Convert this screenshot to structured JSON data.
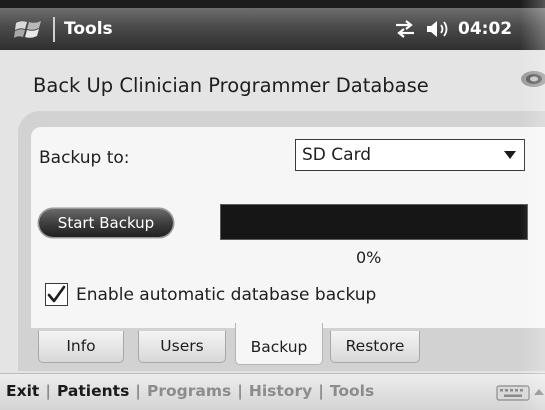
{
  "status_bar": {
    "title": "Tools",
    "time": "04:02",
    "icons": {
      "start": "windows-flag-icon",
      "connectivity": "connectivity-arrows-icon",
      "volume": "speaker-volume-icon"
    }
  },
  "page": {
    "title": "Back Up Clinician Programmer Database",
    "corner_icon": "pod-icon"
  },
  "form": {
    "backup_to_label": "Backup to:",
    "backup_destination": {
      "selected": "SD Card"
    },
    "start_button_label": "Start Backup",
    "progress": {
      "percent": 0,
      "label": "0%"
    },
    "auto_backup": {
      "checked": true,
      "label": "Enable automatic database backup"
    }
  },
  "tabs": [
    {
      "label": "Info",
      "active": false
    },
    {
      "label": "Users",
      "active": false
    },
    {
      "label": "Backup",
      "active": true
    },
    {
      "label": "Restore",
      "active": false
    }
  ],
  "menu": {
    "items": [
      {
        "label": "Exit",
        "enabled": true
      },
      {
        "label": "Patients",
        "enabled": true
      },
      {
        "label": "Programs",
        "enabled": false
      },
      {
        "label": "History",
        "enabled": false
      },
      {
        "label": "Tools",
        "enabled": false
      }
    ],
    "separator": "|",
    "keyboard_icon": "keyboard-icon"
  },
  "colors": {
    "titlebar": "#3a3a3a",
    "progress_track": "#161616",
    "active_text": "#1a1a1a",
    "disabled_text": "#8c8c8c"
  }
}
